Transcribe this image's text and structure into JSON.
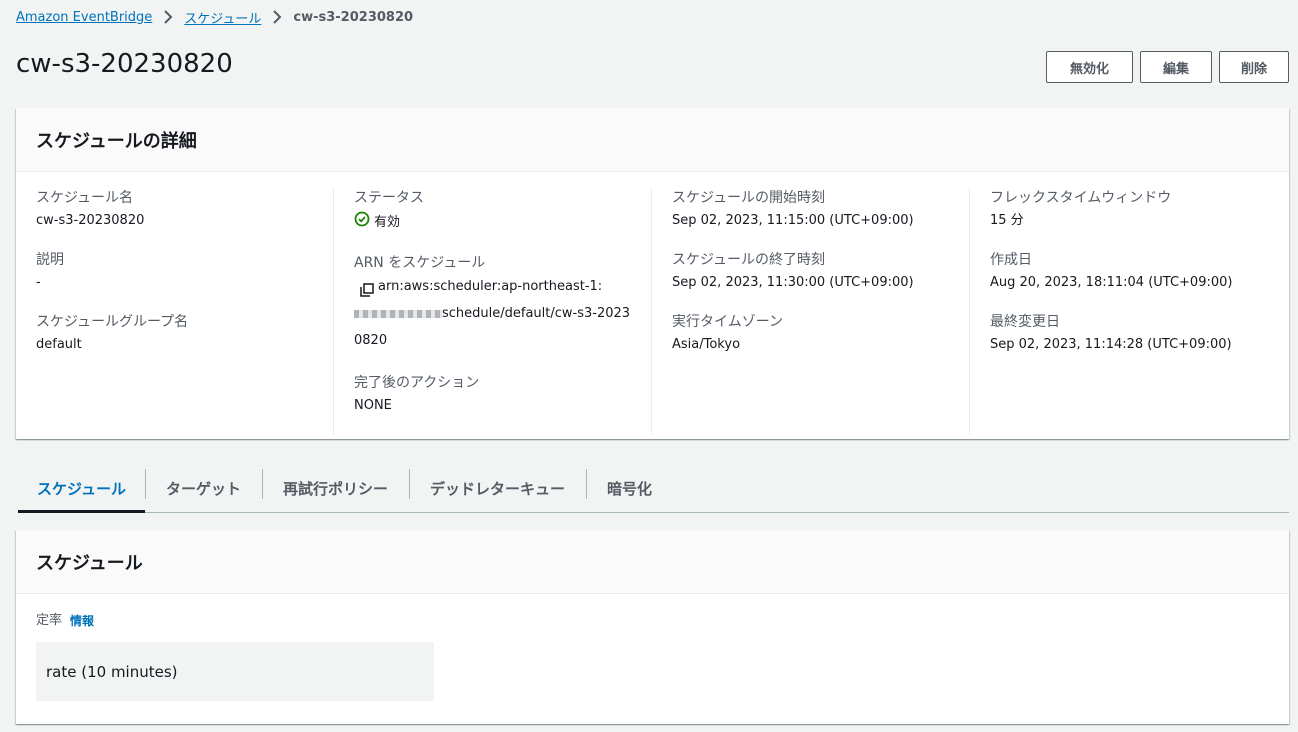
{
  "breadcrumb": {
    "items": [
      "Amazon EventBridge",
      "スケジュール"
    ],
    "current": "cw-s3-20230820"
  },
  "page": {
    "title": "cw-s3-20230820"
  },
  "actions": {
    "disable_label": "無効化",
    "edit_label": "編集",
    "delete_label": "削除"
  },
  "details": {
    "title": "スケジュールの詳細",
    "schedule_name": {
      "label": "スケジュール名",
      "value": "cw-s3-20230820"
    },
    "description": {
      "label": "説明",
      "value": "-"
    },
    "group_name": {
      "label": "スケジュールグループ名",
      "value": "default"
    },
    "status": {
      "label": "ステータス",
      "value": "有効",
      "color": "#1d8102"
    },
    "arn": {
      "label": "ARN をスケジュール",
      "value_prefix": "arn:aws:scheduler:ap-northeast-",
      "value_masked_start": "1:",
      "value_suffix": "schedule/default/cw-s3-20230820"
    },
    "completion_action": {
      "label": "完了後のアクション",
      "value": "NONE"
    },
    "start_time": {
      "label": "スケジュールの開始時刻",
      "value": "Sep 02, 2023, 11:15:00 (UTC+09:00)"
    },
    "end_time": {
      "label": "スケジュールの終了時刻",
      "value": "Sep 02, 2023, 11:30:00 (UTC+09:00)"
    },
    "timezone": {
      "label": "実行タイムゾーン",
      "value": "Asia/Tokyo"
    },
    "flex_window": {
      "label": "フレックスタイムウィンドウ",
      "value": "15 分"
    },
    "created": {
      "label": "作成日",
      "value": "Aug 20, 2023, 18:11:04 (UTC+09:00)"
    },
    "modified": {
      "label": "最終変更日",
      "value": "Sep 02, 2023, 11:14:28 (UTC+09:00)"
    }
  },
  "tabs": [
    {
      "label": "スケジュール",
      "active": true
    },
    {
      "label": "ターゲット",
      "active": false
    },
    {
      "label": "再試行ポリシー",
      "active": false
    },
    {
      "label": "デッドレターキュー",
      "active": false
    },
    {
      "label": "暗号化",
      "active": false
    }
  ],
  "schedule": {
    "title": "スケジュール",
    "rate_label": "定率",
    "info_label": "情報",
    "rate_value": "rate (10 minutes)"
  },
  "colors": {
    "link": "#0073bb",
    "success": "#1d8102",
    "background": "#f2f3f3"
  }
}
